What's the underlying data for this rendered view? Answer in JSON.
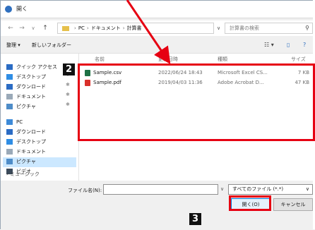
{
  "window": {
    "title": "開く"
  },
  "address": {
    "back_icon": "←",
    "forward_icon": "→",
    "dropdown_icon": "∨",
    "up_icon": "↑",
    "crumbs": [
      "PC",
      "ドキュメント",
      "計算書"
    ],
    "dropdown": "∨",
    "refresh": "↻",
    "search_placeholder": "計算書の検索"
  },
  "toolbar": {
    "organize": "整理 ▾",
    "new_folder": "新しいフォルダー",
    "view": "☷ ▾",
    "pane": "▯",
    "help": "?"
  },
  "sidebar": {
    "items": [
      {
        "label": "クイック アクセス",
        "icon": "star-icon",
        "color": "#2b6cc4",
        "pinned": false
      },
      {
        "label": "デスクトップ",
        "icon": "desktop-icon",
        "color": "#2f8de4",
        "pinned": true
      },
      {
        "label": "ダウンロード",
        "icon": "download-icon",
        "color": "#2b6cc4",
        "pinned": true
      },
      {
        "label": "ドキュメント",
        "icon": "document-icon",
        "color": "#9aa9b8",
        "pinned": true
      },
      {
        "label": "ピクチャ",
        "icon": "picture-icon",
        "color": "#4e8cc8",
        "pinned": true
      },
      {
        "label": "PC",
        "icon": "pc-icon",
        "color": "#3d8ad8",
        "pinned": false
      },
      {
        "label": "ダウンロード",
        "icon": "download-icon",
        "color": "#2b6cc4",
        "pinned": false
      },
      {
        "label": "デスクトップ",
        "icon": "desktop-icon",
        "color": "#2f8de4",
        "pinned": false
      },
      {
        "label": "ドキュメント",
        "icon": "document-icon",
        "color": "#9aa9b8",
        "pinned": false
      },
      {
        "label": "ピクチャ",
        "icon": "picture-icon",
        "color": "#4e8cc8",
        "pinned": false
      },
      {
        "label": "ビデオ",
        "icon": "video-icon",
        "color": "#3b4a5a",
        "pinned": false
      }
    ],
    "selected_index": 8,
    "pin_glyph": "✱",
    "more": "› ミュージック"
  },
  "files": {
    "columns": [
      "名前",
      "更新日時",
      "種類",
      "サイズ"
    ],
    "rows": [
      {
        "name": "Sample.csv",
        "date": "2022/06/24 18:43",
        "type": "Microsoft Excel CS...",
        "size": "7 KB",
        "icon": "excel-file-icon",
        "icon_color": "#1e7145"
      },
      {
        "name": "Sample.pdf",
        "date": "2019/04/03 11:36",
        "type": "Adobe Acrobat D...",
        "size": "47 KB",
        "icon": "pdf-file-icon",
        "icon_color": "#d9302b"
      }
    ]
  },
  "bottom": {
    "filename_label": "ファイル名(N):",
    "filename_value": "",
    "filter": "すべてのファイル (*.*)",
    "open_button": "開く(O)",
    "cancel_button": "キャンセル"
  },
  "annotations": {
    "marker_1": "2",
    "marker_2": "3",
    "highlight_color": "#e60012"
  }
}
